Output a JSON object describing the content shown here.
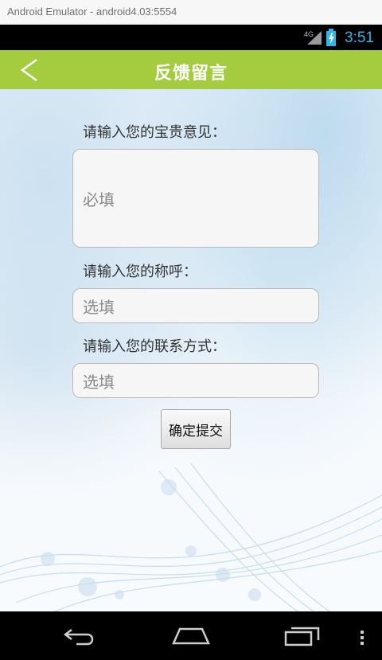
{
  "window": {
    "title": "Android Emulator - android4.03:5554"
  },
  "status_bar": {
    "network": "4G",
    "time": "3:51"
  },
  "app_bar": {
    "title": "反馈留言"
  },
  "form": {
    "opinion_label": "请输入您的宝贵意见：",
    "opinion_placeholder": "必填",
    "name_label": "请输入您的称呼：",
    "name_placeholder": "选填",
    "contact_label": "请输入您的联系方式：",
    "contact_placeholder": "选填",
    "submit_label": "确定提交"
  },
  "colors": {
    "app_bar": "#a5cb3f",
    "clock": "#33b5e5"
  },
  "icons": [
    "back-arrow-icon",
    "signal-icon",
    "battery-icon",
    "nav-back-icon",
    "nav-home-icon",
    "nav-recents-icon",
    "overflow-menu-icon"
  ]
}
